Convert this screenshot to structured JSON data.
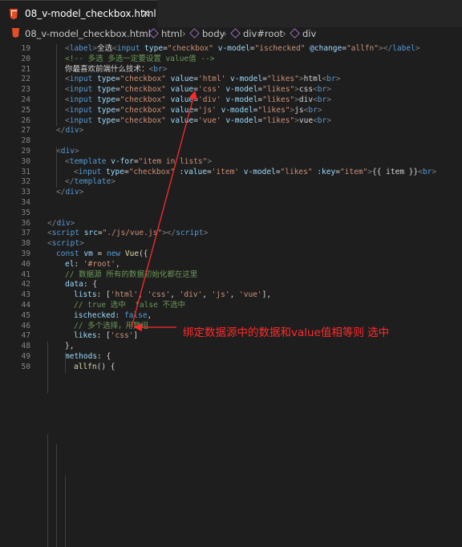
{
  "tab": {
    "title": "08_v-model_checkbox.html",
    "close_glyph": "×",
    "icon": "html5-icon"
  },
  "breadcrumb": {
    "file": "08_v-model_checkbox.html",
    "items": [
      "html",
      "body",
      "div#root",
      "div"
    ],
    "separator": "›"
  },
  "annotation": {
    "text": "绑定数据源中的数据和value值相等则 选中",
    "color": "#ff2a2a"
  },
  "lines": [
    {
      "n": "19",
      "indent": 1,
      "tokens": [
        [
          "t-pun",
          "<"
        ],
        [
          "t-tag",
          "label"
        ],
        [
          "t-pun",
          ">"
        ],
        [
          "t-txt",
          "全选"
        ],
        [
          "t-pun",
          "<"
        ],
        [
          "t-tag",
          "input"
        ],
        [
          "t-txt",
          " "
        ],
        [
          "t-attr",
          "type"
        ],
        [
          "t-txt",
          "="
        ],
        [
          "t-str",
          "\"checkbox\""
        ],
        [
          "t-txt",
          " "
        ],
        [
          "t-attr",
          "v-model"
        ],
        [
          "t-txt",
          "="
        ],
        [
          "t-str",
          "\"ischecked\""
        ],
        [
          "t-txt",
          " "
        ],
        [
          "t-attr",
          "@change"
        ],
        [
          "t-txt",
          "="
        ],
        [
          "t-str",
          "\"allfn\""
        ],
        [
          "t-pun",
          "></"
        ],
        [
          "t-tag",
          "label"
        ],
        [
          "t-pun",
          ">"
        ]
      ]
    },
    {
      "n": "20",
      "indent": 1,
      "tokens": [
        [
          "t-cmt",
          "<!-- 多选 多选一定要设置 value值 -->"
        ]
      ]
    },
    {
      "n": "21",
      "indent": 1,
      "tokens": [
        [
          "t-txt",
          "你最喜欢前端什么技术："
        ],
        [
          "t-pun",
          "<"
        ],
        [
          "t-tag",
          "br"
        ],
        [
          "t-pun",
          ">"
        ]
      ]
    },
    {
      "n": "22",
      "indent": 1,
      "tokens": [
        [
          "t-pun",
          "<"
        ],
        [
          "t-tag",
          "input"
        ],
        [
          "t-txt",
          " "
        ],
        [
          "t-attr",
          "type"
        ],
        [
          "t-txt",
          "="
        ],
        [
          "t-str",
          "\"checkbox\""
        ],
        [
          "t-txt",
          " "
        ],
        [
          "t-attr",
          "value"
        ],
        [
          "t-txt",
          "="
        ],
        [
          "t-str",
          "'html'"
        ],
        [
          "t-txt",
          " "
        ],
        [
          "t-attr",
          "v-model"
        ],
        [
          "t-txt",
          "="
        ],
        [
          "t-str",
          "\"likes\""
        ],
        [
          "t-pun",
          ">"
        ],
        [
          "t-txt",
          "html"
        ],
        [
          "t-pun",
          "<"
        ],
        [
          "t-tag",
          "br"
        ],
        [
          "t-pun",
          ">"
        ]
      ]
    },
    {
      "n": "23",
      "indent": 1,
      "tokens": [
        [
          "t-pun",
          "<"
        ],
        [
          "t-tag",
          "input"
        ],
        [
          "t-txt",
          " "
        ],
        [
          "t-attr",
          "type"
        ],
        [
          "t-txt",
          "="
        ],
        [
          "t-str",
          "\"checkbox\""
        ],
        [
          "t-txt",
          " "
        ],
        [
          "t-attr",
          "value"
        ],
        [
          "t-txt",
          "="
        ],
        [
          "t-str",
          "'css'"
        ],
        [
          "t-txt",
          " "
        ],
        [
          "t-attr",
          "v-model"
        ],
        [
          "t-txt",
          "="
        ],
        [
          "t-str",
          "\"likes\""
        ],
        [
          "t-pun",
          ">"
        ],
        [
          "t-txt",
          "css"
        ],
        [
          "t-pun",
          "<"
        ],
        [
          "t-tag",
          "br"
        ],
        [
          "t-pun",
          ">"
        ]
      ]
    },
    {
      "n": "24",
      "indent": 1,
      "tokens": [
        [
          "t-pun",
          "<"
        ],
        [
          "t-tag",
          "input"
        ],
        [
          "t-txt",
          " "
        ],
        [
          "t-attr",
          "type"
        ],
        [
          "t-txt",
          "="
        ],
        [
          "t-str",
          "\"checkbox\""
        ],
        [
          "t-txt",
          " "
        ],
        [
          "t-attr",
          "value"
        ],
        [
          "t-txt",
          "="
        ],
        [
          "t-str",
          "'div'"
        ],
        [
          "t-txt",
          " "
        ],
        [
          "t-attr",
          "v-model"
        ],
        [
          "t-txt",
          "="
        ],
        [
          "t-str",
          "\"likes\""
        ],
        [
          "t-pun",
          ">"
        ],
        [
          "t-txt",
          "div"
        ],
        [
          "t-pun",
          "<"
        ],
        [
          "t-tag",
          "br"
        ],
        [
          "t-pun",
          ">"
        ]
      ]
    },
    {
      "n": "25",
      "indent": 1,
      "tokens": [
        [
          "t-pun",
          "<"
        ],
        [
          "t-tag",
          "input"
        ],
        [
          "t-txt",
          " "
        ],
        [
          "t-attr",
          "type"
        ],
        [
          "t-txt",
          "="
        ],
        [
          "t-str",
          "\"checkbox\""
        ],
        [
          "t-txt",
          " "
        ],
        [
          "t-attr",
          "value"
        ],
        [
          "t-txt",
          "="
        ],
        [
          "t-str",
          "'js'"
        ],
        [
          "t-txt",
          " "
        ],
        [
          "t-attr",
          "v-model"
        ],
        [
          "t-txt",
          "="
        ],
        [
          "t-str",
          "\"likes\""
        ],
        [
          "t-pun",
          ">"
        ],
        [
          "t-txt",
          "js"
        ],
        [
          "t-pun",
          "<"
        ],
        [
          "t-tag",
          "br"
        ],
        [
          "t-pun",
          ">"
        ]
      ]
    },
    {
      "n": "26",
      "indent": 1,
      "tokens": [
        [
          "t-pun",
          "<"
        ],
        [
          "t-tag",
          "input"
        ],
        [
          "t-txt",
          " "
        ],
        [
          "t-attr",
          "type"
        ],
        [
          "t-txt",
          "="
        ],
        [
          "t-str",
          "\"checkbox\""
        ],
        [
          "t-txt",
          " "
        ],
        [
          "t-attr",
          "value"
        ],
        [
          "t-txt",
          "="
        ],
        [
          "t-str",
          "'vue'"
        ],
        [
          "t-txt",
          " "
        ],
        [
          "t-attr",
          "v-model"
        ],
        [
          "t-txt",
          "="
        ],
        [
          "t-str",
          "\"likes\""
        ],
        [
          "t-pun",
          ">"
        ],
        [
          "t-txt",
          "vue"
        ],
        [
          "t-pun",
          "<"
        ],
        [
          "t-tag",
          "br"
        ],
        [
          "t-pun",
          ">"
        ]
      ]
    },
    {
      "n": "27",
      "indent": 0,
      "tokens": [
        [
          "t-pun",
          "</"
        ],
        [
          "t-tag",
          "div"
        ],
        [
          "t-pun",
          ">"
        ]
      ]
    },
    {
      "n": "28",
      "indent": 0,
      "tokens": []
    },
    {
      "n": "29",
      "indent": 0,
      "tokens": [
        [
          "t-pun",
          "<"
        ],
        [
          "t-tag",
          "div"
        ],
        [
          "t-pun",
          ">"
        ]
      ]
    },
    {
      "n": "30",
      "indent": 1,
      "tokens": [
        [
          "t-pun",
          "<"
        ],
        [
          "t-tag",
          "template"
        ],
        [
          "t-txt",
          " "
        ],
        [
          "t-attr",
          "v-for"
        ],
        [
          "t-txt",
          "="
        ],
        [
          "t-str",
          "\"item in lists\""
        ],
        [
          "t-pun",
          ">"
        ]
      ]
    },
    {
      "n": "31",
      "indent": 2,
      "tokens": [
        [
          "t-pun",
          "<"
        ],
        [
          "t-tag",
          "input"
        ],
        [
          "t-txt",
          " "
        ],
        [
          "t-attr",
          "type"
        ],
        [
          "t-txt",
          "="
        ],
        [
          "t-str",
          "\"checkbox\""
        ],
        [
          "t-txt",
          " "
        ],
        [
          "t-attr",
          ":value"
        ],
        [
          "t-txt",
          "="
        ],
        [
          "t-str",
          "'item'"
        ],
        [
          "t-txt",
          " "
        ],
        [
          "t-attr",
          "v-model"
        ],
        [
          "t-txt",
          "="
        ],
        [
          "t-str",
          "\"likes\""
        ],
        [
          "t-txt",
          " "
        ],
        [
          "t-attr",
          ":key"
        ],
        [
          "t-txt",
          "="
        ],
        [
          "t-str",
          "\"item\""
        ],
        [
          "t-pun",
          ">"
        ],
        [
          "t-txt",
          "{{ item }}"
        ],
        [
          "t-pun",
          "<"
        ],
        [
          "t-tag",
          "br"
        ],
        [
          "t-pun",
          ">"
        ]
      ]
    },
    {
      "n": "32",
      "indent": 1,
      "tokens": [
        [
          "t-pun",
          "</"
        ],
        [
          "t-tag",
          "template"
        ],
        [
          "t-pun",
          ">"
        ]
      ]
    },
    {
      "n": "33",
      "indent": 0,
      "tokens": [
        [
          "t-pun",
          "</"
        ],
        [
          "t-tag",
          "div"
        ],
        [
          "t-pun",
          ">"
        ]
      ]
    },
    {
      "n": "34",
      "indent": 0,
      "tokens": []
    },
    {
      "n": "35",
      "indent": 0,
      "tokens": []
    },
    {
      "n": "36",
      "indent": -1,
      "tokens": [
        [
          "t-pun",
          "</"
        ],
        [
          "t-tag",
          "div"
        ],
        [
          "t-pun",
          ">"
        ]
      ]
    },
    {
      "n": "37",
      "indent": -1,
      "tokens": [
        [
          "t-pun",
          "<"
        ],
        [
          "t-tag",
          "script"
        ],
        [
          "t-txt",
          " "
        ],
        [
          "t-attr",
          "src"
        ],
        [
          "t-txt",
          "="
        ],
        [
          "t-str",
          "\"./js/vue.js\""
        ],
        [
          "t-pun",
          "></"
        ],
        [
          "t-tag",
          "script"
        ],
        [
          "t-pun",
          ">"
        ]
      ]
    },
    {
      "n": "38",
      "indent": -1,
      "tokens": [
        [
          "t-pun",
          "<"
        ],
        [
          "t-tag",
          "script"
        ],
        [
          "t-pun",
          ">"
        ]
      ]
    },
    {
      "n": "39",
      "indent": 0,
      "tokens": [
        [
          "t-kw",
          "const"
        ],
        [
          "t-txt",
          " "
        ],
        [
          "t-var",
          "vm"
        ],
        [
          "t-txt",
          " = "
        ],
        [
          "t-kw",
          "new"
        ],
        [
          "t-txt",
          " "
        ],
        [
          "t-fn",
          "Vue"
        ],
        [
          "t-txt",
          "({"
        ]
      ]
    },
    {
      "n": "40",
      "indent": 1,
      "tokens": [
        [
          "t-prop",
          "el"
        ],
        [
          "t-txt",
          ": "
        ],
        [
          "t-str",
          "'#root'"
        ],
        [
          "t-txt",
          ","
        ]
      ]
    },
    {
      "n": "41",
      "indent": 1,
      "tokens": [
        [
          "t-cmt",
          "// 数据源 所有的数据初始化都在这里"
        ]
      ]
    },
    {
      "n": "42",
      "indent": 1,
      "tokens": [
        [
          "t-prop",
          "data"
        ],
        [
          "t-txt",
          ": {"
        ]
      ]
    },
    {
      "n": "43",
      "indent": 2,
      "tokens": [
        [
          "t-prop",
          "lists"
        ],
        [
          "t-txt",
          ": ["
        ],
        [
          "t-str",
          "'html'"
        ],
        [
          "t-txt",
          ", "
        ],
        [
          "t-str",
          "'css'"
        ],
        [
          "t-txt",
          ", "
        ],
        [
          "t-str",
          "'div'"
        ],
        [
          "t-txt",
          ", "
        ],
        [
          "t-str",
          "'js'"
        ],
        [
          "t-txt",
          ", "
        ],
        [
          "t-str",
          "'vue'"
        ],
        [
          "t-txt",
          "],"
        ]
      ]
    },
    {
      "n": "44",
      "indent": 2,
      "tokens": [
        [
          "t-cmt",
          "// true 选中  false 不选中"
        ]
      ]
    },
    {
      "n": "45",
      "indent": 2,
      "tokens": [
        [
          "t-prop",
          "ischecked"
        ],
        [
          "t-txt",
          ": "
        ],
        [
          "t-kw",
          "false"
        ],
        [
          "t-txt",
          ","
        ]
      ]
    },
    {
      "n": "46",
      "indent": 2,
      "tokens": [
        [
          "t-cmt",
          "// 多个选择，用数组"
        ]
      ]
    },
    {
      "n": "47",
      "indent": 2,
      "tokens": [
        [
          "t-prop",
          "likes"
        ],
        [
          "t-txt",
          ": ["
        ],
        [
          "t-str",
          "'css'"
        ],
        [
          "t-txt",
          "]"
        ]
      ]
    },
    {
      "n": "48",
      "indent": 1,
      "tokens": [
        [
          "t-txt",
          "},"
        ]
      ]
    },
    {
      "n": "49",
      "indent": 1,
      "tokens": [
        [
          "t-prop",
          "methods"
        ],
        [
          "t-txt",
          ": {"
        ]
      ]
    },
    {
      "n": "50",
      "indent": 2,
      "tokens": [
        [
          "t-fn",
          "allfn"
        ],
        [
          "t-txt",
          "() {"
        ]
      ]
    }
  ]
}
